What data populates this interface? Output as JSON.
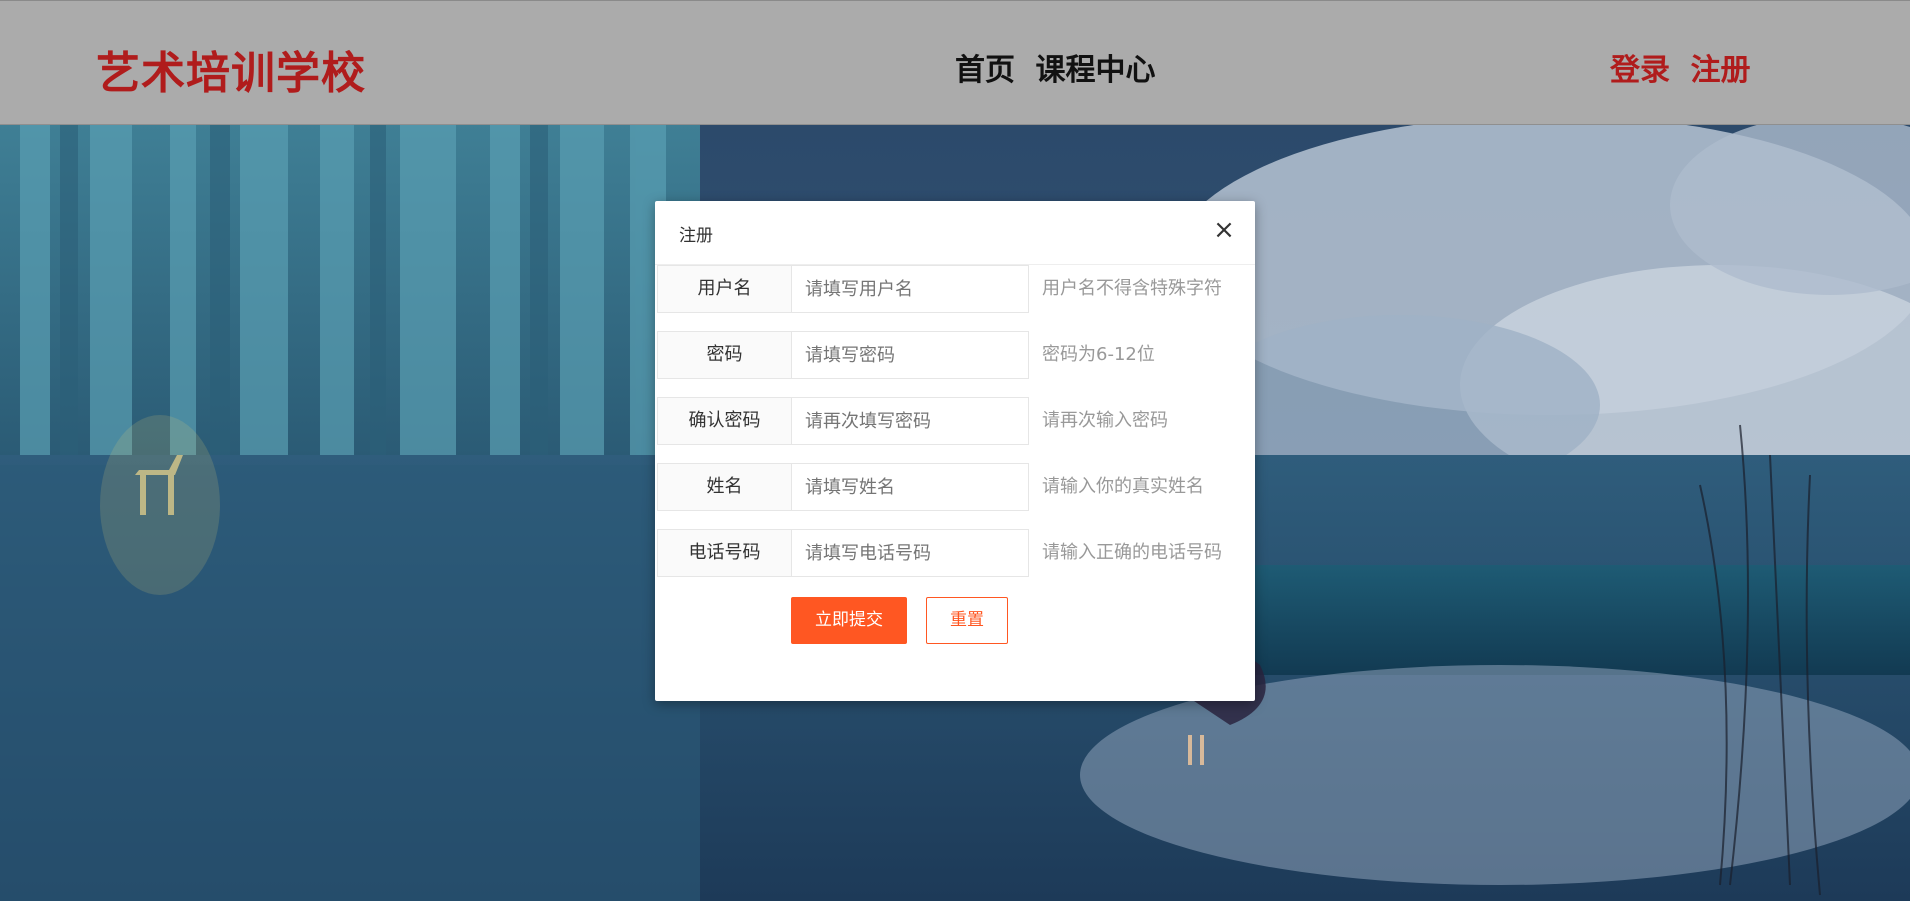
{
  "header": {
    "logo": "艺术培训学校",
    "nav": [
      "首页",
      "课程中心"
    ],
    "auth": [
      "登录",
      "注册"
    ]
  },
  "modal": {
    "title": "注册",
    "close_icon": "close-icon",
    "fields": [
      {
        "label": "用户名",
        "placeholder": "请填写用户名",
        "value": "",
        "hint": "用户名不得含特殊字符"
      },
      {
        "label": "密码",
        "placeholder": "请填写密码",
        "value": "",
        "hint": "密码为6-12位"
      },
      {
        "label": "确认密码",
        "placeholder": "请再次填写密码",
        "value": "",
        "hint": "请再次输入密码"
      },
      {
        "label": "姓名",
        "placeholder": "请填写姓名",
        "value": "",
        "hint": "请输入你的真实姓名"
      },
      {
        "label": "电话号码",
        "placeholder": "请填写电话号码",
        "value": "",
        "hint": "请输入正确的电话号码"
      }
    ],
    "submit_label": "立即提交",
    "reset_label": "重置"
  },
  "colors": {
    "brand_red": "#b01c1c",
    "accent_orange": "#ff5722",
    "header_gray": "#ababab"
  }
}
